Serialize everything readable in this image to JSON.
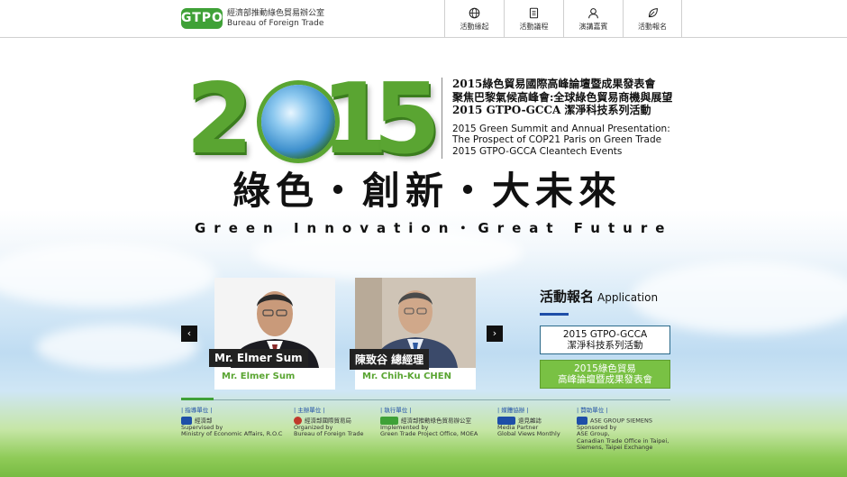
{
  "header": {
    "logo_mark": "GTPO",
    "org_zh": "經濟部推動綠色貿易辦公室",
    "org_en": "Bureau of Foreign Trade",
    "nav": [
      {
        "label": "活動緣起",
        "icon": "globe-icon"
      },
      {
        "label": "活動議程",
        "icon": "document-icon"
      },
      {
        "label": "演講嘉賓",
        "icon": "person-icon"
      },
      {
        "label": "活動報名",
        "icon": "leaf-icon"
      }
    ]
  },
  "hero": {
    "year_digits": [
      "2",
      "1",
      "5"
    ],
    "title_zh": [
      "2015綠色貿易國際高峰論壇暨成果發表會",
      "聚焦巴黎氣候高峰會:全球綠色貿易商機與展望",
      "2015 GTPO-GCCA 潔淨科技系列活動"
    ],
    "title_en": [
      "2015 Green Summit and Annual Presentation:",
      "The Prospect of COP21 Paris on Green Trade",
      "2015 GTPO-GCCA Cleantech Events"
    ],
    "slogan_zh": "綠色・創新・大未來",
    "slogan_en": "Green Innovation・Great Future"
  },
  "speakers": {
    "prev_glyph": "‹",
    "next_glyph": "›",
    "items": [
      {
        "caption": "Mr. Elmer Sum",
        "name": "Mr. Elmer Sum"
      },
      {
        "caption": "陳致谷 總經理",
        "name": "Mr. Chih-Ku CHEN"
      }
    ]
  },
  "registration": {
    "title": "活動報名",
    "title_sub": "Application",
    "button1": [
      "2015 GTPO-GCCA",
      "潔淨科技系列活動"
    ],
    "button2": [
      "2015綠色貿易",
      "高峰論壇暨成果發表會"
    ]
  },
  "footer": {
    "partners": [
      {
        "head": "| 指導單位 |",
        "logo": "經濟部",
        "lines": [
          "Supervised by",
          "Ministry of Economic Affairs, R.O.C"
        ],
        "color": "#1e4ea8"
      },
      {
        "head": "| 主辦單位 |",
        "logo": "經濟部國際貿易局",
        "lines": [
          "Organized by",
          "Bureau of Foreign Trade"
        ],
        "color": "#c0392b"
      },
      {
        "head": "| 執行單位 |",
        "logo": "經濟部推動綠色貿易辦公室",
        "lines": [
          "Implemented by",
          "Green Trade Project Office, MOEA"
        ],
        "color": "#3fa137"
      },
      {
        "head": "| 媒體協辦 |",
        "logo": "遠見雜誌",
        "lines": [
          "Media Partner",
          "Global Views Monthly"
        ],
        "color": "#1e4ea8"
      },
      {
        "head": "| 贊助單位 |",
        "logo": "ASE GROUP  SIEMENS",
        "lines": [
          "Sponsored by",
          "ASE Group,",
          "Canadian Trade Office in Taipei,",
          "Siemens, Taipei Exchange"
        ],
        "color": "#1e4ea8"
      }
    ]
  }
}
